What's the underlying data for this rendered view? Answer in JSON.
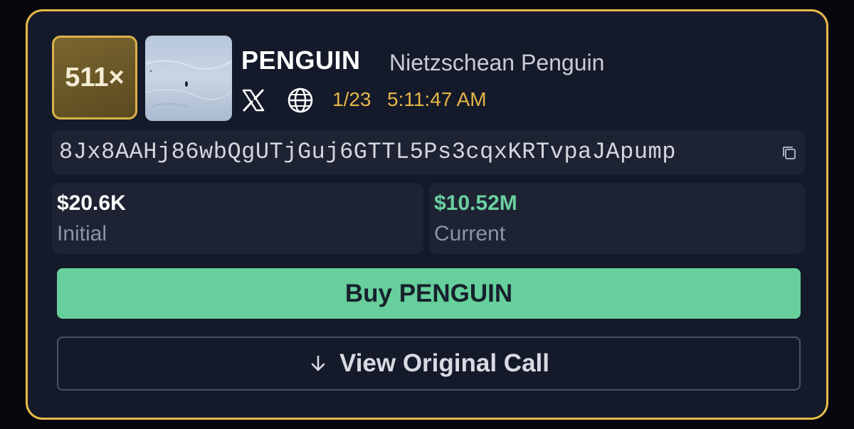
{
  "multiplier": "511×",
  "token": {
    "ticker": "PENGUIN",
    "name": "Nietzschean Penguin",
    "date": "1/23",
    "time": "5:11:47 AM",
    "address": "8Jx8AAHj86wbQgUTjGuj6GTTL5Ps3cqxKRTvpaJApump"
  },
  "icons": {
    "x": "x-logo-icon",
    "web": "globe-icon",
    "copy": "copy-icon",
    "arrow": "arrow-down-icon"
  },
  "stats": {
    "initial_value": "$20.6K",
    "initial_label": "Initial",
    "current_value": "$10.52M",
    "current_label": "Current"
  },
  "actions": {
    "buy_label": "Buy PENGUIN",
    "view_label": "View Original Call"
  },
  "colors": {
    "border": "#e7b94b",
    "accent_green": "#66cf9b",
    "timestamp": "#e6b54a",
    "card_bg": "#141a29"
  }
}
